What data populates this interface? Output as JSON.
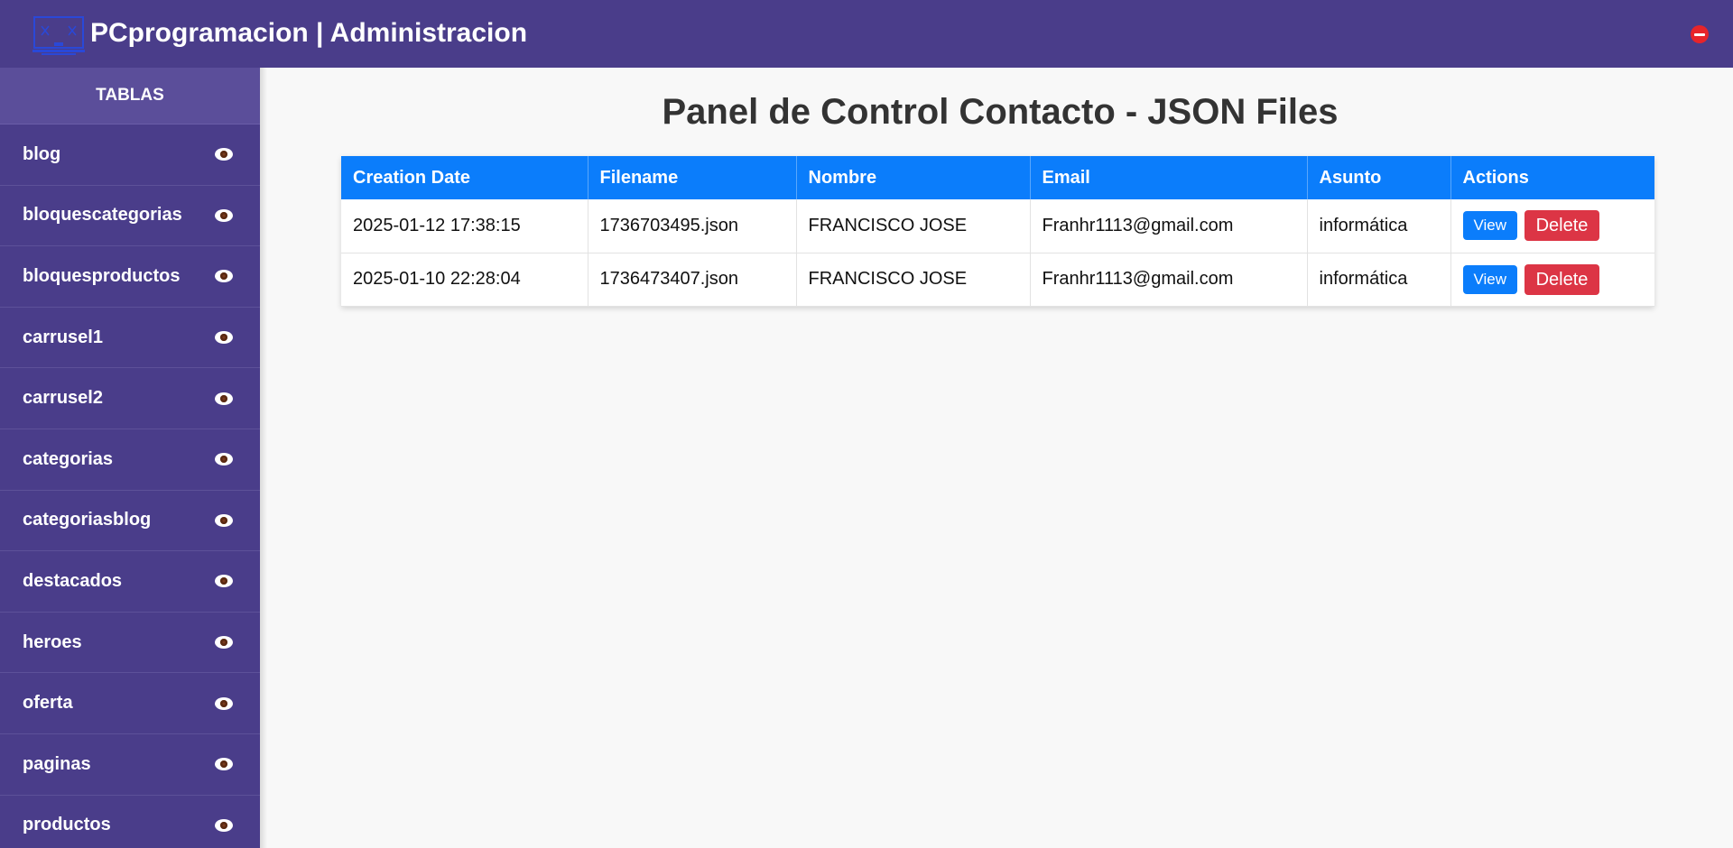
{
  "header": {
    "brand": "PCprogramacion | Administracion",
    "logo_icon": "monitor-logo-icon",
    "logout_icon": "no-entry-icon",
    "background": "#4a3d8a"
  },
  "sidebar": {
    "title": "TABLAS",
    "item_icon": "eye-icon",
    "items": [
      {
        "label": "blog"
      },
      {
        "label": "bloquescategorias"
      },
      {
        "label": "bloquesproductos"
      },
      {
        "label": "carrusel1"
      },
      {
        "label": "carrusel2"
      },
      {
        "label": "categorias"
      },
      {
        "label": "categoriasblog"
      },
      {
        "label": "destacados"
      },
      {
        "label": "heroes"
      },
      {
        "label": "oferta"
      },
      {
        "label": "paginas"
      },
      {
        "label": "productos"
      }
    ]
  },
  "main": {
    "title": "Panel de Control Contacto - JSON Files"
  },
  "table": {
    "headers": [
      "Creation Date",
      "Filename",
      "Nombre",
      "Email",
      "Asunto",
      "Actions"
    ],
    "rows": [
      {
        "creation_date": "2025-01-12 17:38:15",
        "filename": "1736703495.json",
        "nombre": "FRANCISCO JOSE",
        "email": "Franhr1113@gmail.com",
        "asunto": "informática",
        "view_label": "View",
        "delete_label": "Delete"
      },
      {
        "creation_date": "2025-01-10 22:28:04",
        "filename": "1736473407.json",
        "nombre": "FRANCISCO JOSE",
        "email": "Franhr1113@gmail.com",
        "asunto": "informática",
        "view_label": "View",
        "delete_label": "Delete"
      }
    ],
    "header_color": "#0b7dfb",
    "delete_color": "#dc3545"
  }
}
